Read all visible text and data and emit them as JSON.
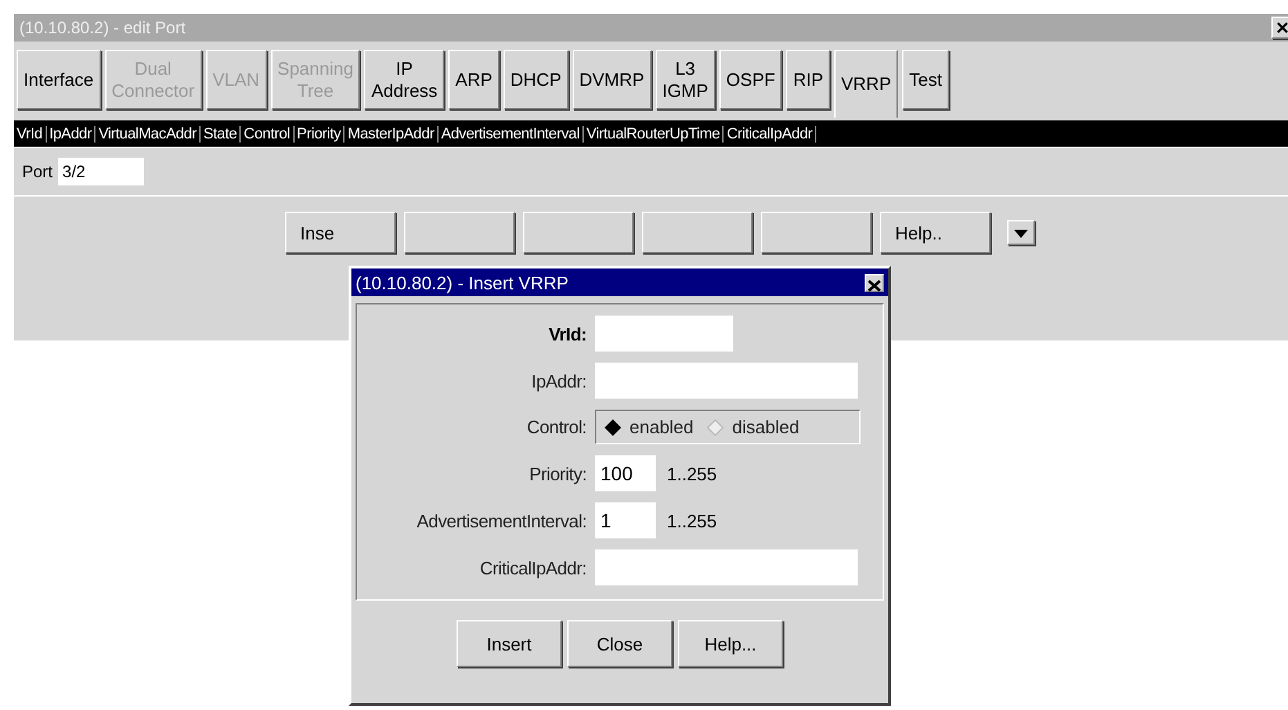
{
  "window": {
    "title": "(10.10.80.2) - edit Port"
  },
  "tabs": [
    {
      "label": "Interface",
      "selected": false,
      "disabled": false
    },
    {
      "label": "Dual Connector",
      "selected": false,
      "disabled": true
    },
    {
      "label": "VLAN",
      "selected": false,
      "disabled": true
    },
    {
      "label": "Spanning Tree",
      "selected": false,
      "disabled": true
    },
    {
      "label": "IP Address",
      "selected": false,
      "disabled": false
    },
    {
      "label": "ARP",
      "selected": false,
      "disabled": false
    },
    {
      "label": "DHCP",
      "selected": false,
      "disabled": false
    },
    {
      "label": "DVMRP",
      "selected": false,
      "disabled": false
    },
    {
      "label": "L3 IGMP",
      "selected": false,
      "disabled": false
    },
    {
      "label": "OSPF",
      "selected": false,
      "disabled": false
    },
    {
      "label": "RIP",
      "selected": false,
      "disabled": false
    },
    {
      "label": "VRRP",
      "selected": true,
      "disabled": false
    },
    {
      "label": "Test",
      "selected": false,
      "disabled": false
    }
  ],
  "table": {
    "columns": [
      "VrId",
      "IpAddr",
      "VirtualMacAddr",
      "State",
      "Control",
      "Priority",
      "MasterIpAddr",
      "AdvertisementInterval",
      "VirtualRouterUpTime",
      "CriticalIpAddr"
    ]
  },
  "port": {
    "label": "Port",
    "value": "3/2"
  },
  "toolbar_buttons": [
    {
      "kind": "labeled",
      "label": "Inse"
    },
    {
      "kind": "covered"
    },
    {
      "kind": "covered"
    },
    {
      "kind": "covered"
    },
    {
      "kind": "covered"
    },
    {
      "kind": "labeled",
      "label": "Help.."
    }
  ],
  "dialog": {
    "title": "(10.10.80.2) - Insert VRRP",
    "fields": [
      {
        "kind": "short_text",
        "label": "VrId:",
        "required": true
      },
      {
        "kind": "text",
        "label": "IpAddr:",
        "required": false
      },
      {
        "kind": "radio",
        "label": "Control:",
        "required": false,
        "options": [
          {
            "label": "enabled",
            "selected": true
          },
          {
            "label": "disabled",
            "selected": false
          }
        ]
      },
      {
        "kind": "number",
        "label": "Priority:",
        "required": false,
        "value": "100",
        "range": "1..255"
      },
      {
        "kind": "number",
        "label": "AdvertisementInterval:",
        "required": false,
        "value": "1",
        "range": "1..255"
      },
      {
        "kind": "text",
        "label": "CriticalIpAddr:",
        "required": false
      }
    ],
    "buttons": [
      "Insert",
      "Close",
      "Help..."
    ]
  }
}
